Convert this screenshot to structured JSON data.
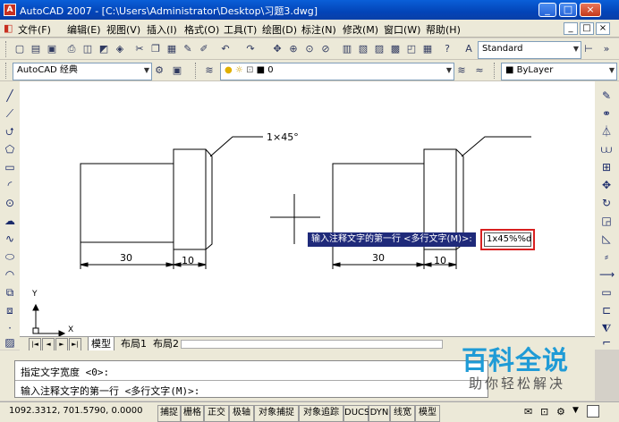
{
  "window": {
    "title": "AutoCAD 2007 - [C:\\Users\\Administrator\\Desktop\\习题3.dwg]",
    "minimize_glyph": "_",
    "maximize_glyph": "□",
    "close_glyph": "×"
  },
  "menu": {
    "items": [
      "文件(F)",
      "编辑(E)",
      "视图(V)",
      "插入(I)",
      "格式(O)",
      "工具(T)",
      "绘图(D)",
      "标注(N)",
      "修改(M)",
      "窗口(W)",
      "帮助(H)"
    ]
  },
  "mdi_controls": [
    "_",
    "□",
    "×"
  ],
  "toolbar_row2": {
    "text_style": "Standard"
  },
  "toolbar_row3": {
    "workspace": "AutoCAD 经典",
    "layer": "0",
    "linetype": "ByLayer"
  },
  "drawing": {
    "left": {
      "dim_30": "30",
      "dim_10": "10",
      "leader_text": "1×45°"
    },
    "right": {
      "dim_30": "30",
      "dim_10": "10"
    },
    "prompt": "输入注释文字的第一行 <多行文字(M)>:",
    "input_value": "1x45%%d",
    "ucs_y": "Y",
    "ucs_x": "X"
  },
  "tabs": {
    "nav": [
      "|◄",
      "◄",
      "►",
      "►|"
    ],
    "items": [
      "模型",
      "布局1",
      "布局2"
    ]
  },
  "command": {
    "line1": "指定文字宽度 <0>:",
    "line2": "输入注释文字的第一行 <多行文字(M)>:"
  },
  "status": {
    "coords": "1092.3312,  701.5790,  0.0000",
    "buttons": [
      "捕捉",
      "栅格",
      "正交",
      "极轴",
      "对象捕捉",
      "对象追踪",
      "DUCS",
      "DYN",
      "线宽",
      "模型"
    ]
  },
  "watermark": {
    "title": "百科全说",
    "subtitle": "助你轻松解决"
  },
  "colors": {
    "title_bar": "#0a4fc8",
    "prompt_bg": "#1f2a7a",
    "input_border": "#d82020",
    "watermark": "#1f9bd6"
  }
}
